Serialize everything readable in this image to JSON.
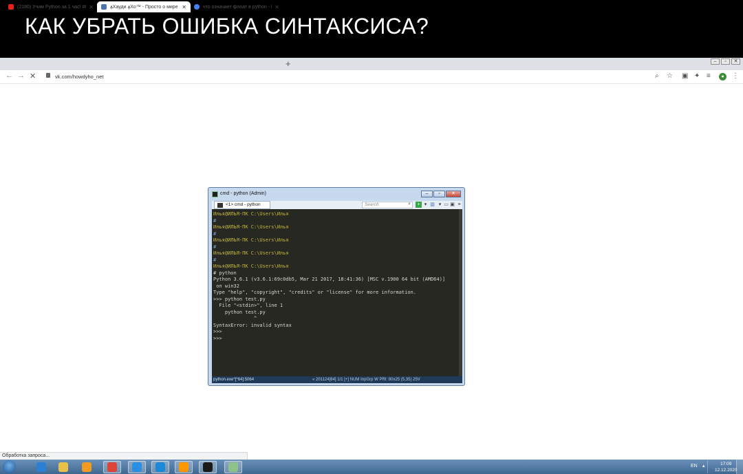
{
  "banner": {
    "title": "КАК УБРАТЬ ОШИБКА СИНТАКСИСА?"
  },
  "browser": {
    "tabs": [
      {
        "label": "(2180) Учим Python за 1 час! #С",
        "favicon_color": "#e62117",
        "active": false
      },
      {
        "label": "ꙟХауди ꙟХо™ - Просто о мире",
        "favicon_color": "#4a76a8",
        "active": true
      },
      {
        "label": "что означает флоат в python - П",
        "favicon_color": "#4285f4",
        "active": false
      }
    ],
    "tab_close": "✕",
    "new_tab": "+",
    "url": "vk.com/howdyho_net",
    "window_controls": [
      "‒",
      "▫",
      "✕"
    ],
    "loading_status": "Обработка запроса..."
  },
  "console": {
    "title": "cmd - python (Admin)",
    "tab_label": "<1> cmd - python",
    "search_placeholder": "Search",
    "controls": [
      "‒",
      "▫",
      "✕"
    ],
    "lines": [
      {
        "text": "Илья@ИЛЬЯ-ПК C:\\Users\\Илья",
        "kind": "prompt"
      },
      {
        "text": "#",
        "kind": "hash"
      },
      {
        "text": "Илья@ИЛЬЯ-ПК C:\\Users\\Илья",
        "kind": "prompt"
      },
      {
        "text": "#",
        "kind": "hash"
      },
      {
        "text": "Илья@ИЛЬЯ-ПК C:\\Users\\Илья",
        "kind": "prompt"
      },
      {
        "text": "#",
        "kind": "hash"
      },
      {
        "text": "Илья@ИЛЬЯ-ПК C:\\Users\\Илья",
        "kind": "prompt"
      },
      {
        "text": "#",
        "kind": "hash"
      },
      {
        "text": "Илья@ИЛЬЯ-ПК C:\\Users\\Илья",
        "kind": "prompt"
      },
      {
        "text": "# python",
        "kind": "text"
      },
      {
        "text": "Python 3.6.1 (v3.6.1:69c0db5, Mar 21 2017, 18:41:36) [MSC v.1900 64 bit (AMD64)]",
        "kind": "text"
      },
      {
        "text": " on win32",
        "kind": "text"
      },
      {
        "text": "Type \"help\", \"copyright\", \"credits\" or \"license\" for more information.",
        "kind": "text"
      },
      {
        "text": ">>> python test.py",
        "kind": "text"
      },
      {
        "text": "  File \"<stdin>\", line 1",
        "kind": "text"
      },
      {
        "text": "    python test.py",
        "kind": "text"
      },
      {
        "text": "              ^",
        "kind": "text"
      },
      {
        "text": "SyntaxError: invalid syntax",
        "kind": "text"
      },
      {
        "text": ">>>",
        "kind": "text"
      },
      {
        "text": ">>>",
        "kind": "text"
      }
    ],
    "status_left": "python.exe*[*64]:5064",
    "status_right": "« 201124[64]   1/1   [+] NUM  InpGrp  W   PRI:   80x25      (5,35) 25V"
  },
  "taskbar": {
    "language": "EN",
    "time": "17:09",
    "date": "12.12.2020",
    "apps": [
      {
        "name": "ie-icon",
        "color": "#2d7fd3"
      },
      {
        "name": "explorer-icon",
        "color": "#e8c04a"
      },
      {
        "name": "media-player-icon",
        "color": "#f29b1f"
      },
      {
        "name": "chrome-icon",
        "color": "#db4437"
      },
      {
        "name": "app-w-icon",
        "color": "#2a8ee3"
      },
      {
        "name": "app-z-icon",
        "color": "#1d8ad8"
      },
      {
        "name": "sublime-icon",
        "color": "#ff9800"
      },
      {
        "name": "console-icon",
        "color": "#1a1a1a"
      },
      {
        "name": "conemu-icon",
        "color": "#8fc28a"
      }
    ]
  }
}
